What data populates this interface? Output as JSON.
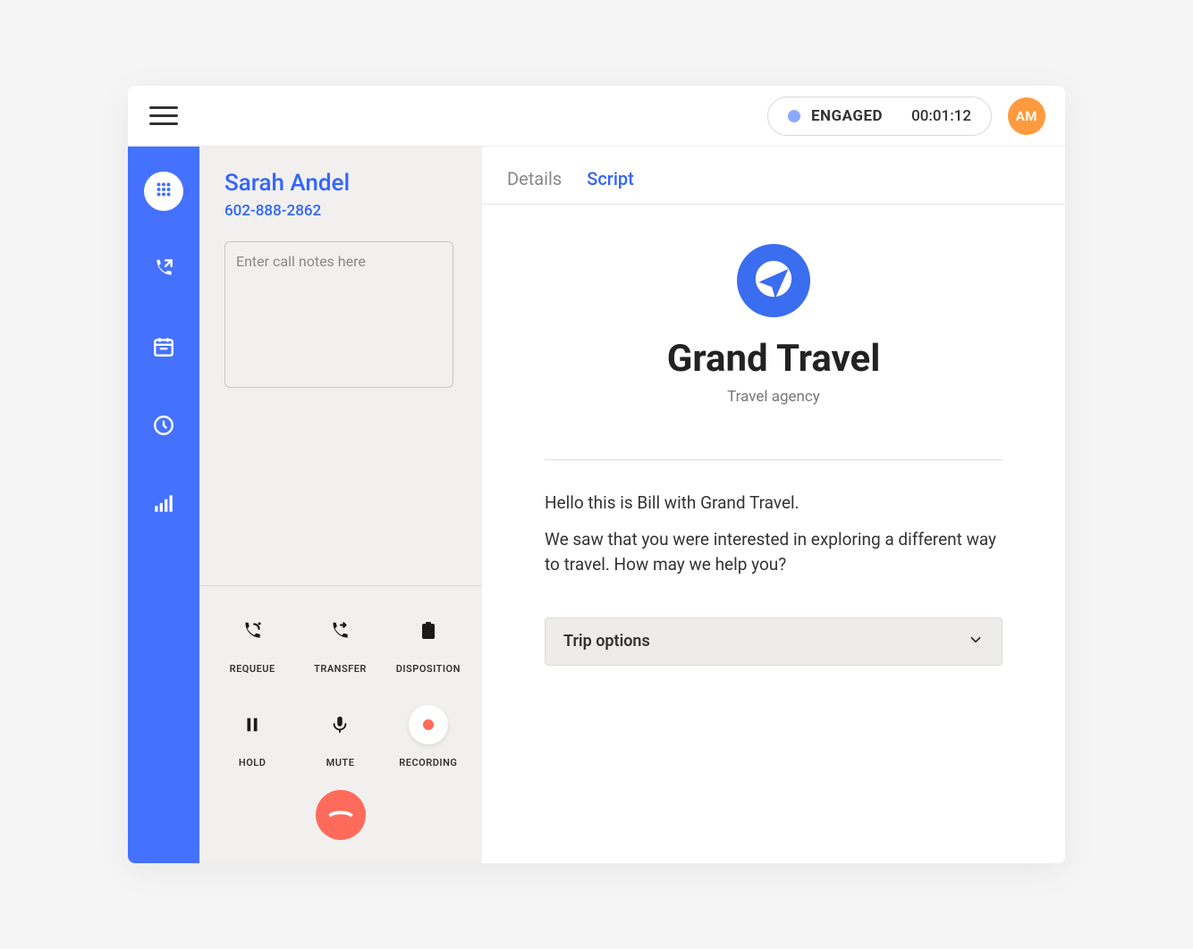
{
  "topbar": {
    "status_label": "ENGAGED",
    "status_time": "00:01:12",
    "avatar_initials": "AM"
  },
  "sidebar": {
    "items": [
      {
        "name": "dialpad-icon"
      },
      {
        "name": "outbound-call-icon"
      },
      {
        "name": "calendar-icon"
      },
      {
        "name": "clock-icon"
      },
      {
        "name": "signal-icon"
      }
    ]
  },
  "caller": {
    "name": "Sarah Andel",
    "phone": "602-888-2862",
    "notes_placeholder": "Enter call notes here"
  },
  "controls": {
    "requeue": "REQUEUE",
    "transfer": "TRANSFER",
    "disposition": "DISPOSITION",
    "hold": "HOLD",
    "mute": "MUTE",
    "recording": "RECORDING"
  },
  "tabs": {
    "details": "Details",
    "script": "Script"
  },
  "script": {
    "brand_name": "Grand Travel",
    "brand_sub": "Travel agency",
    "line1": "Hello this is Bill with Grand Travel.",
    "line2": "We saw that you were interested in exploring a different way to travel. How may we help you?",
    "accordion_label": "Trip options"
  },
  "colors": {
    "primary": "#4571ff",
    "link": "#3264ff",
    "accent_orange": "#ff9b3e",
    "accent_red": "#ff6b5b"
  }
}
